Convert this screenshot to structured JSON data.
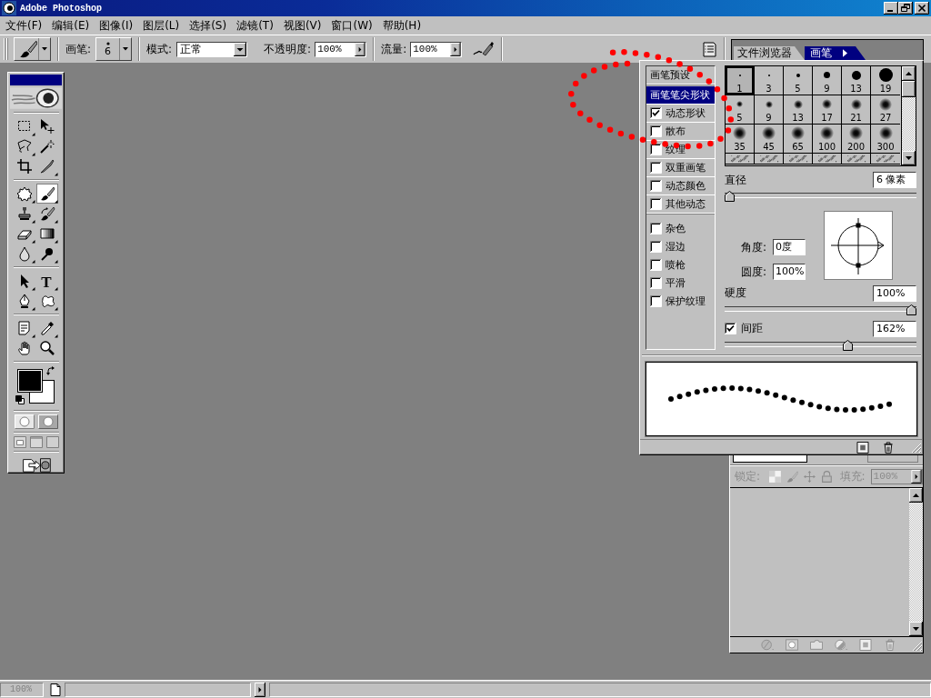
{
  "window": {
    "title": "Adobe Photoshop"
  },
  "menu": [
    "文件(F)",
    "编辑(E)",
    "图像(I)",
    "图层(L)",
    "选择(S)",
    "滤镜(T)",
    "视图(V)",
    "窗口(W)",
    "帮助(H)"
  ],
  "options_bar": {
    "brush_label": "画笔:",
    "brush_size": "6",
    "mode_label": "模式:",
    "mode": "正常",
    "opacity_label": "不透明度:",
    "opacity": "100%",
    "flow_label": "流量:",
    "flow": "100%"
  },
  "palette_well": {
    "tabs": [
      {
        "label": "文件浏览器",
        "selected": false
      },
      {
        "label": "画笔",
        "selected": true
      }
    ]
  },
  "toolbox": {
    "tool_groups": [
      [
        {
          "selected": false,
          "flyout": true
        },
        {
          "selected": false,
          "flyout": false
        },
        {
          "selected": false,
          "flyout": true
        },
        {
          "selected": false,
          "flyout": false
        },
        {
          "selected": false,
          "flyout": false
        },
        {
          "selected": false,
          "flyout": true
        }
      ],
      [
        {
          "selected": false,
          "flyout": true
        },
        {
          "selected": true,
          "flyout": true
        },
        {
          "selected": false,
          "flyout": true
        },
        {
          "selected": false,
          "flyout": true
        },
        {
          "selected": false,
          "flyout": true
        },
        {
          "selected": false,
          "flyout": true
        },
        {
          "selected": false,
          "flyout": true
        },
        {
          "selected": false,
          "flyout": true
        }
      ],
      [
        {
          "selected": false,
          "flyout": true
        },
        {
          "glyph": "T",
          "selected": false,
          "flyout": true
        },
        {
          "selected": false,
          "flyout": true
        },
        {
          "selected": false,
          "flyout": true
        }
      ],
      [
        {
          "selected": false,
          "flyout": true
        },
        {
          "selected": false,
          "flyout": true
        },
        {
          "selected": false,
          "flyout": false
        },
        {
          "selected": false,
          "flyout": false
        }
      ]
    ],
    "swatches": [
      {
        "color": "#000000"
      },
      {
        "color": "#ffffff"
      }
    ]
  },
  "brushes_panel": {
    "sections": [
      {
        "ruled": true,
        "items": [
          {
            "kind": "page",
            "label": "画笔预设",
            "selected": false
          }
        ]
      },
      {
        "ruled": true,
        "items": [
          {
            "kind": "page",
            "label": "画笔笔尖形状",
            "selected": true
          },
          {
            "kind": "checkbox",
            "label": "动态形状",
            "checked": true,
            "selected": false
          },
          {
            "kind": "checkbox",
            "label": "散布",
            "checked": false,
            "selected": false
          },
          {
            "kind": "checkbox",
            "label": "纹理",
            "checked": false,
            "selected": false
          },
          {
            "kind": "checkbox",
            "label": "双重画笔",
            "checked": false,
            "selected": false
          },
          {
            "kind": "checkbox",
            "label": "动态颜色",
            "checked": false,
            "selected": false
          },
          {
            "kind": "checkbox",
            "label": "其他动态",
            "checked": false,
            "selected": false
          }
        ]
      },
      {
        "ruled": false,
        "items": [
          {
            "kind": "checkbox",
            "label": "杂色",
            "checked": false,
            "selected": false
          },
          {
            "kind": "checkbox",
            "label": "湿边",
            "checked": false,
            "selected": false
          },
          {
            "kind": "checkbox",
            "label": "喷枪",
            "checked": false,
            "selected": false
          },
          {
            "kind": "checkbox",
            "label": "平滑",
            "checked": false,
            "selected": false
          },
          {
            "kind": "checkbox",
            "label": "保护纹理",
            "checked": false,
            "selected": false
          }
        ]
      }
    ],
    "tips": [
      {
        "kind": "hard",
        "label": "1",
        "selected": true
      },
      {
        "kind": "hard",
        "label": "3",
        "selected": false
      },
      {
        "kind": "hard",
        "label": "5",
        "selected": false
      },
      {
        "kind": "hard",
        "label": "9",
        "selected": false
      },
      {
        "kind": "hard",
        "label": "13",
        "selected": false
      },
      {
        "kind": "hard",
        "label": "19",
        "selected": false
      },
      {
        "kind": "soft",
        "label": "5",
        "selected": false
      },
      {
        "kind": "soft",
        "label": "9",
        "selected": false
      },
      {
        "kind": "soft",
        "label": "13",
        "selected": false
      },
      {
        "kind": "soft",
        "label": "17",
        "selected": false
      },
      {
        "kind": "soft",
        "label": "21",
        "selected": false
      },
      {
        "kind": "soft",
        "label": "27",
        "selected": false
      },
      {
        "kind": "soft",
        "label": "35",
        "selected": false
      },
      {
        "kind": "soft",
        "label": "45",
        "selected": false
      },
      {
        "kind": "soft",
        "label": "65",
        "selected": false
      },
      {
        "kind": "soft",
        "label": "100",
        "selected": false
      },
      {
        "kind": "soft",
        "label": "200",
        "selected": false
      },
      {
        "kind": "soft",
        "label": "300",
        "selected": false
      },
      {
        "kind": "scatter",
        "selected": false
      },
      {
        "kind": "scatter",
        "selected": false
      },
      {
        "kind": "scatter",
        "selected": false
      },
      {
        "kind": "scatter",
        "selected": false
      },
      {
        "kind": "scatter",
        "selected": false
      },
      {
        "kind": "scatter",
        "selected": false
      }
    ],
    "diameter": {
      "label": "直径",
      "value": "6 像素",
      "level": 0
    },
    "angle": {
      "label": "角度:",
      "value": "0度"
    },
    "roundness": {
      "label": "圆度:",
      "value": "100%"
    },
    "hardness": {
      "label": "硬度",
      "value": "100%",
      "level": 1
    },
    "spacing": {
      "label": "间距",
      "checked": true,
      "value": "162%",
      "level": 0.65
    }
  },
  "layers_panel": {
    "lock_label": "锁定:",
    "fill_label": "填充:",
    "fill": "100%",
    "disabled": true
  },
  "status_bar": {
    "zoom": "100%",
    "disabled": true
  }
}
